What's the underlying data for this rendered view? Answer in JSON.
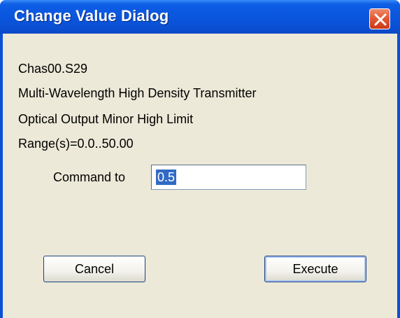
{
  "window": {
    "title": "Change Value Dialog",
    "close_icon": "close-x-icon",
    "accent": "#0a55dc",
    "close_color": "#e35a36"
  },
  "info": {
    "item_id": "Chas00.S29",
    "device": "Multi-Wavelength High Density Transmitter",
    "parameter": "Optical Output Minor High Limit",
    "range": "Range(s)=0.0..50.00"
  },
  "command": {
    "label": "Command to",
    "value": "0.5"
  },
  "buttons": {
    "cancel": "Cancel",
    "execute": "Execute"
  }
}
